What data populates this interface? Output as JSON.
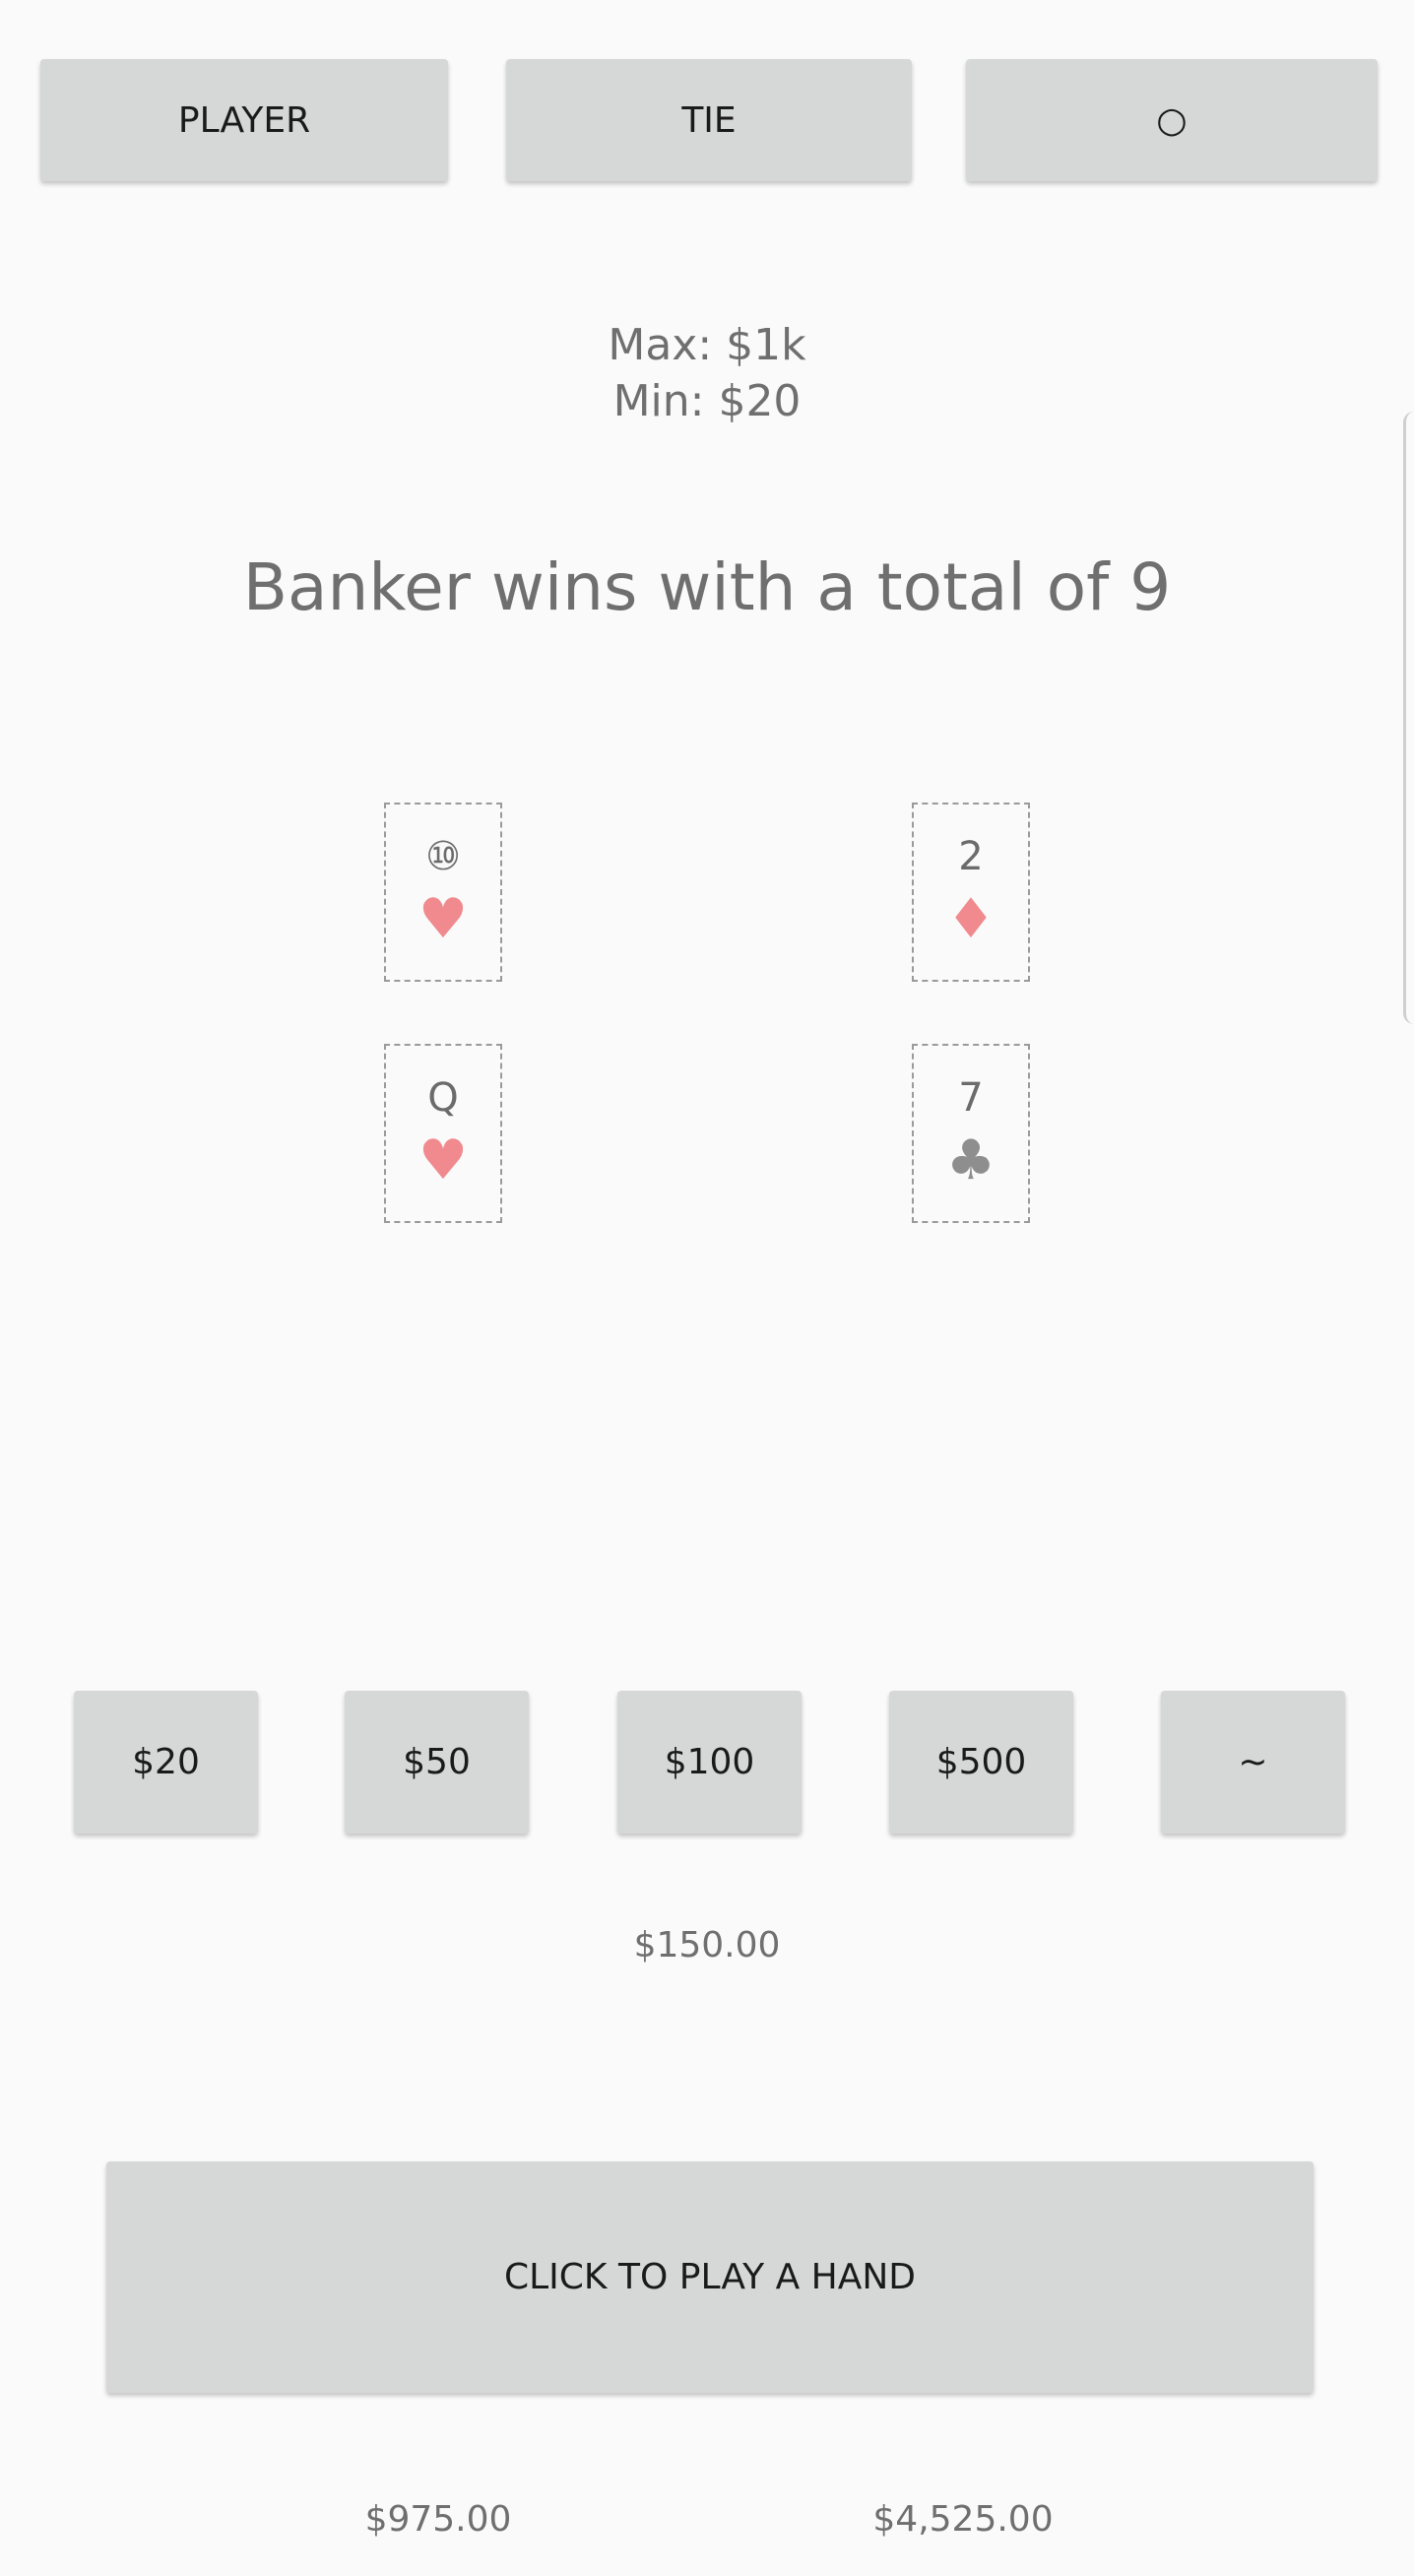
{
  "bet_options": {
    "player": "PLAYER",
    "tie": "TIE",
    "banker": "○"
  },
  "limits": {
    "max": "Max: $1k",
    "min": "Min: $20"
  },
  "result": "Banker wins with a total of 9",
  "player_cards": [
    {
      "rank": "⑩",
      "suit": "♥",
      "color": "#f08a8e"
    },
    {
      "rank": "Q",
      "suit": "♥",
      "color": "#f08a8e"
    }
  ],
  "banker_cards": [
    {
      "rank": "2",
      "suit": "♦",
      "color": "#f08a8e"
    },
    {
      "rank": "7",
      "suit": "♣",
      "color": "#8e8e8e"
    }
  ],
  "chips": [
    "$20",
    "$50",
    "$100",
    "$500",
    "~"
  ],
  "current_bet": "$150.00",
  "play_button": "CLICK TO PLAY A HAND",
  "balances": {
    "left": "$975.00",
    "right": "$4,525.00"
  }
}
